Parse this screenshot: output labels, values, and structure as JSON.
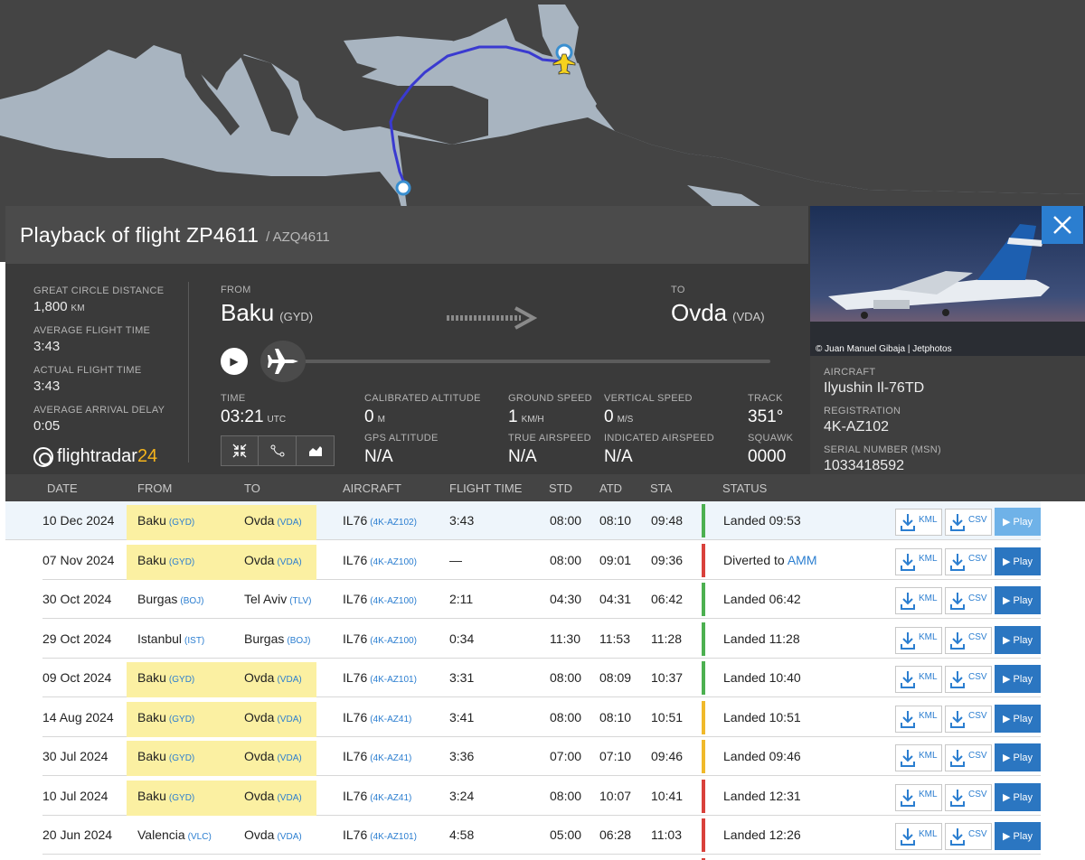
{
  "flight": {
    "title": "Playback of flight ZP4611",
    "callsign": "/ AZQ4611"
  },
  "stats": [
    {
      "label": "GREAT CIRCLE DISTANCE",
      "value": "1,800",
      "unit": "KM"
    },
    {
      "label": "AVERAGE FLIGHT TIME",
      "value": "3:43",
      "unit": ""
    },
    {
      "label": "ACTUAL FLIGHT TIME",
      "value": "3:43",
      "unit": ""
    },
    {
      "label": "AVERAGE ARRIVAL DELAY",
      "value": "0:05",
      "unit": ""
    }
  ],
  "logo": {
    "text": "flightradar",
    "num": "24"
  },
  "route": {
    "from_label": "FROM",
    "from_city": "Baku",
    "from_code": "(GYD)",
    "to_label": "TO",
    "to_city": "Ovda",
    "to_code": "(VDA)"
  },
  "playback": {
    "progress": 0.0
  },
  "telemetry": {
    "time_label": "TIME",
    "time_value": "03:21",
    "time_unit": "UTC",
    "cal_alt_label": "CALIBRATED ALTITUDE",
    "cal_alt_value": "0",
    "cal_alt_unit": "M",
    "gps_alt_label": "GPS ALTITUDE",
    "gps_alt_value": "N/A",
    "ground_speed_label": "GROUND SPEED",
    "ground_speed_value": "1",
    "ground_speed_unit": "KM/H",
    "true_airspeed_label": "TRUE AIRSPEED",
    "true_airspeed_value": "N/A",
    "vertical_speed_label": "VERTICAL SPEED",
    "vertical_speed_value": "0",
    "vertical_speed_unit": "M/S",
    "indicated_airspeed_label": "INDICATED AIRSPEED",
    "indicated_airspeed_value": "N/A",
    "track_label": "TRACK",
    "track_value": "351°",
    "squawk_label": "SQUAWK",
    "squawk_value": "0000"
  },
  "aircraft": {
    "photo_credit": "© Juan Manuel Gibaja | Jetphotos",
    "aircraft_label": "AIRCRAFT",
    "aircraft_value": "Ilyushin Il-76TD",
    "registration_label": "REGISTRATION",
    "registration_value": "4K-AZ102",
    "serial_label": "SERIAL NUMBER (MSN)",
    "serial_value": "1033418592"
  },
  "table": {
    "headers": [
      "DATE",
      "FROM",
      "TO",
      "AIRCRAFT",
      "FLIGHT TIME",
      "STD",
      "ATD",
      "STA",
      "STATUS"
    ],
    "kml_label": "KML",
    "csv_label": "CSV",
    "play_label": "▶ Play",
    "rows": [
      {
        "date": "10 Dec 2024",
        "from": "Baku",
        "from_code": "(GYD)",
        "to": "Ovda",
        "to_code": "(VDA)",
        "type": "IL76",
        "reg": "(4K-AZ102)",
        "time": "3:43",
        "std": "08:00",
        "atd": "08:10",
        "sta": "09:48",
        "status": "Landed 09:53",
        "status_link": "",
        "color": "#4cb050",
        "highlight": true,
        "selected": true
      },
      {
        "date": "07 Nov 2024",
        "from": "Baku",
        "from_code": "(GYD)",
        "to": "Ovda",
        "to_code": "(VDA)",
        "type": "IL76",
        "reg": "(4K-AZ100)",
        "time": "—",
        "std": "08:00",
        "atd": "09:01",
        "sta": "09:36",
        "status": "Diverted to",
        "status_link": "AMM",
        "color": "#d9413b",
        "highlight": true,
        "selected": false
      },
      {
        "date": "30 Oct 2024",
        "from": "Burgas",
        "from_code": "(BOJ)",
        "to": "Tel Aviv",
        "to_code": "(TLV)",
        "type": "IL76",
        "reg": "(4K-AZ100)",
        "time": "2:11",
        "std": "04:30",
        "atd": "04:31",
        "sta": "06:42",
        "status": "Landed 06:42",
        "status_link": "",
        "color": "#4cb050",
        "highlight": false,
        "selected": false
      },
      {
        "date": "29 Oct 2024",
        "from": "Istanbul",
        "from_code": "(IST)",
        "to": "Burgas",
        "to_code": "(BOJ)",
        "type": "IL76",
        "reg": "(4K-AZ100)",
        "time": "0:34",
        "std": "11:30",
        "atd": "11:53",
        "sta": "11:28",
        "status": "Landed 11:28",
        "status_link": "",
        "color": "#4cb050",
        "highlight": false,
        "selected": false
      },
      {
        "date": "09 Oct 2024",
        "from": "Baku",
        "from_code": "(GYD)",
        "to": "Ovda",
        "to_code": "(VDA)",
        "type": "IL76",
        "reg": "(4K-AZ101)",
        "time": "3:31",
        "std": "08:00",
        "atd": "08:09",
        "sta": "10:37",
        "status": "Landed 10:40",
        "status_link": "",
        "color": "#4cb050",
        "highlight": true,
        "selected": false
      },
      {
        "date": "14 Aug 2024",
        "from": "Baku",
        "from_code": "(GYD)",
        "to": "Ovda",
        "to_code": "(VDA)",
        "type": "IL76",
        "reg": "(4K-AZ41)",
        "time": "3:41",
        "std": "08:00",
        "atd": "08:10",
        "sta": "10:51",
        "status": "Landed 10:51",
        "status_link": "",
        "color": "#f0b92a",
        "highlight": true,
        "selected": false
      },
      {
        "date": "30 Jul 2024",
        "from": "Baku",
        "from_code": "(GYD)",
        "to": "Ovda",
        "to_code": "(VDA)",
        "type": "IL76",
        "reg": "(4K-AZ41)",
        "time": "3:36",
        "std": "07:00",
        "atd": "07:10",
        "sta": "09:46",
        "status": "Landed 09:46",
        "status_link": "",
        "color": "#f0b92a",
        "highlight": true,
        "selected": false
      },
      {
        "date": "10 Jul 2024",
        "from": "Baku",
        "from_code": "(GYD)",
        "to": "Ovda",
        "to_code": "(VDA)",
        "type": "IL76",
        "reg": "(4K-AZ41)",
        "time": "3:24",
        "std": "08:00",
        "atd": "10:07",
        "sta": "10:41",
        "status": "Landed 12:31",
        "status_link": "",
        "color": "#d9413b",
        "highlight": true,
        "selected": false
      },
      {
        "date": "20 Jun 2024",
        "from": "Valencia",
        "from_code": "(VLC)",
        "to": "Ovda",
        "to_code": "(VDA)",
        "type": "IL76",
        "reg": "(4K-AZ101)",
        "time": "4:58",
        "std": "05:00",
        "atd": "06:28",
        "sta": "11:03",
        "status": "Landed 12:26",
        "status_link": "",
        "color": "#d9413b",
        "highlight": false,
        "selected": false
      },
      {
        "date": "",
        "from": "",
        "from_code": "",
        "to": "",
        "to_code": "",
        "type": "",
        "reg": "",
        "time": "",
        "std": "",
        "atd": "",
        "sta": "",
        "status": "",
        "status_link": "",
        "color": "#d9413b",
        "highlight": false,
        "selected": false
      }
    ]
  }
}
